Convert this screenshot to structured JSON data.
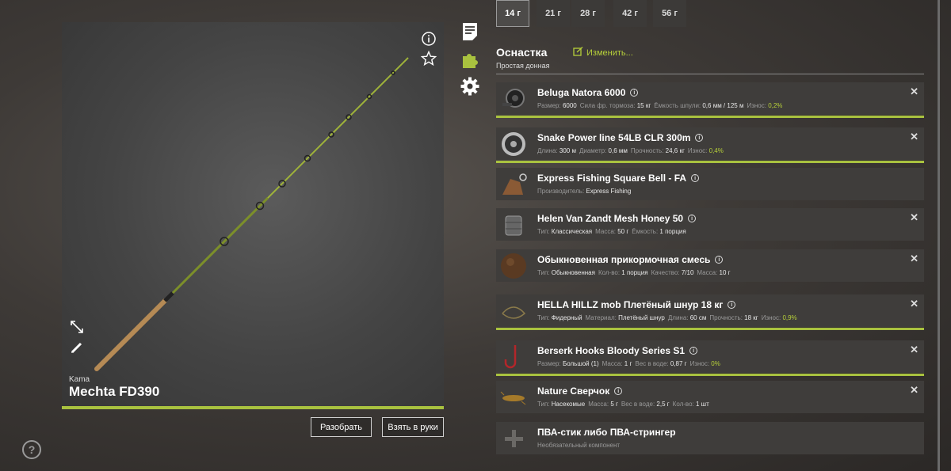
{
  "weights": [
    "14 г",
    "21 г",
    "28 г",
    "42 г",
    "56 г"
  ],
  "rod": {
    "brand": "Kama",
    "model": "Mechta FD390"
  },
  "buttons": {
    "disassemble": "Разобрать",
    "take": "Взять в руки"
  },
  "help": "?",
  "section": {
    "title": "Оснастка",
    "subtitle": "Простая донная",
    "edit": "Изменить..."
  },
  "colors": {
    "accent": "#a9c23f",
    "highlight": "#b6cf3a",
    "panel": "#3f3d3b"
  },
  "items": [
    {
      "name": "Beluga Natora 6000",
      "icon": "reel-icon",
      "closable": true,
      "bar": 1.0,
      "stats": [
        [
          "Размер:",
          "6000"
        ],
        [
          "Сила фр. тормоза:",
          "15 кг"
        ],
        [
          "Ёмкость шпули:",
          "0,6 мм / 125 м"
        ],
        [
          "Износ:",
          "0,2%",
          "g"
        ]
      ]
    },
    {
      "name": "Snake Power line 54LB CLR 300m",
      "icon": "line-spool-icon",
      "closable": true,
      "bar": 1.0,
      "stats": [
        [
          "Длина:",
          "300 м"
        ],
        [
          "Диаметр:",
          "0,6 мм"
        ],
        [
          "Прочность:",
          "24,6 кг"
        ],
        [
          "Износ:",
          "0,4%",
          "g"
        ]
      ]
    },
    {
      "name": "Express Fishing Square Bell - FA",
      "icon": "sinker-icon",
      "closable": false,
      "bar": 0,
      "stats": [
        [
          "Производитель:",
          "Express Fishing"
        ]
      ]
    },
    {
      "name": "Helen Van Zandt Mesh Honey 50",
      "icon": "feeder-icon",
      "closable": true,
      "bar": 0,
      "stats": [
        [
          "Тип:",
          "Классическая"
        ],
        [
          "Масса:",
          "50 г"
        ],
        [
          "Ёмкость:",
          "1 порция"
        ]
      ]
    },
    {
      "name": "Обыкновенная прикормочная смесь",
      "icon": "groundbait-icon",
      "closable": true,
      "bar": 0,
      "stats": [
        [
          "Тип:",
          "Обыкновенная"
        ],
        [
          "Кол-во:",
          "1 порция"
        ],
        [
          "Качество:",
          "7/10"
        ],
        [
          "Масса:",
          "10 г"
        ]
      ]
    },
    {
      "name": "HELLA HILLZ mob Плетёный шнур 18 кг",
      "icon": "leader-icon",
      "closable": true,
      "bar": 1.0,
      "stats": [
        [
          "Тип:",
          "Фидерный"
        ],
        [
          "Материал:",
          "Плетёный шнур"
        ],
        [
          "Длина:",
          "60 см"
        ],
        [
          "Прочность:",
          "18 кг"
        ],
        [
          "Износ:",
          "0,9%",
          "g"
        ]
      ]
    },
    {
      "name": "Berserk Hooks Bloody Series S1",
      "icon": "hook-icon",
      "closable": true,
      "bar": 1.0,
      "stats": [
        [
          "Размер:",
          "Большой (1)"
        ],
        [
          "Масса:",
          "1 г"
        ],
        [
          "Вес в воде:",
          "0,87 г"
        ],
        [
          "Износ:",
          "0%",
          "g"
        ]
      ]
    },
    {
      "name": "Nature Сверчок",
      "icon": "cricket-bait-icon",
      "closable": true,
      "bar": 0,
      "stats": [
        [
          "Тип:",
          "Насекомые"
        ],
        [
          "Масса:",
          "5 г"
        ],
        [
          "Вес в воде:",
          "2,5 г"
        ],
        [
          "Кол-во:",
          "1 шт"
        ]
      ]
    },
    {
      "name": "ПВА-стик либо ПВА-стрингер",
      "icon": "plus-icon",
      "closable": false,
      "bar": 0,
      "stats": [
        [
          "Необязательный компонент"
        ]
      ]
    }
  ]
}
